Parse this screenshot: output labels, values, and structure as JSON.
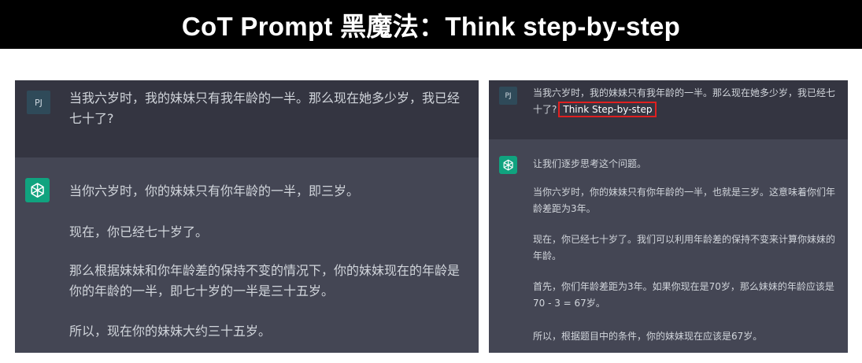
{
  "header": {
    "title": "CoT Prompt 黑魔法：Think step-by-step"
  },
  "left": {
    "user": {
      "avatar": "PJ",
      "text": "当我六岁时，我的妹妹只有我年龄的一半。那么现在她多少岁，我已经七十了?"
    },
    "assistant": {
      "icon": "chatgpt-logo-icon",
      "paragraphs": [
        "当你六岁时，你的妹妹只有你年龄的一半，即三岁。",
        "现在，你已经七十岁了。",
        "那么根据妹妹和你年龄差的保持不变的情况下，你的妹妹现在的年龄是你的年龄的一半，即七十岁的一半是三十五岁。",
        "所以，现在你的妹妹大约三十五岁。"
      ]
    }
  },
  "right": {
    "user": {
      "avatar": "PJ",
      "text": "当我六岁时，我的妹妹只有我年龄的一半。那么现在她多少岁，我已经七十了?",
      "highlight": "Think Step-by-step"
    },
    "assistant": {
      "icon": "chatgpt-logo-icon",
      "paragraphs": [
        "让我们逐步思考这个问题。",
        "当你六岁时，你的妹妹只有你年龄的一半，也就是三岁。这意味着你们年龄差距为3年。",
        "现在，你已经七十岁了。我们可以利用年龄差的保持不变来计算你妹妹的年龄。",
        "首先，你们年龄差距为3年。如果你现在是70岁，那么妹妹的年龄应该是70 - 3 = 67岁。",
        "所以，根据题目中的条件，你的妹妹现在应该是67岁。"
      ]
    }
  },
  "colors": {
    "user_bg": "#343541",
    "assistant_bg": "#444654",
    "avatar_user": "#2f4a59",
    "avatar_gpt": "#10a37f",
    "highlight_border": "#e02020"
  }
}
